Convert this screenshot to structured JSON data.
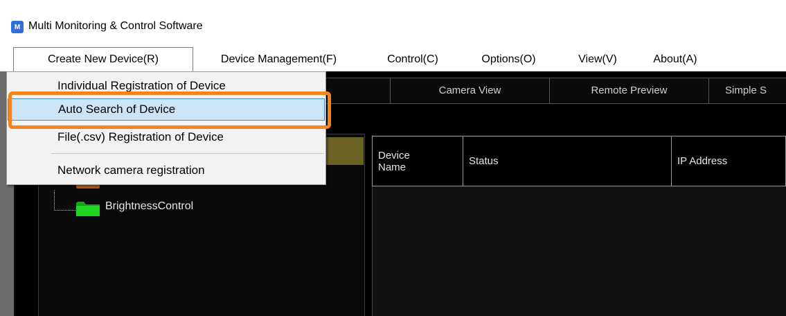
{
  "window": {
    "title": "Multi Monitoring & Control Software",
    "icon": "app-logo-icon",
    "icon_text": "M"
  },
  "menubar": {
    "items": [
      {
        "label": "Create New Device(R)",
        "open": true
      },
      {
        "label": "Device Management(F)"
      },
      {
        "label": "Control(C)"
      },
      {
        "label": "Options(O)"
      },
      {
        "label": "View(V)"
      },
      {
        "label": "About(A)"
      }
    ]
  },
  "dropdown": {
    "items": [
      {
        "label": "Individual Registration of Device"
      },
      {
        "label": "Auto Search of Device",
        "highlighted": true
      },
      {
        "label": "File(.csv) Registration of Device"
      },
      {
        "label": "Network camera registration"
      }
    ]
  },
  "viewbar": {
    "tabs": [
      {
        "label": ""
      },
      {
        "label": "Camera View"
      },
      {
        "label": "Remote Preview"
      },
      {
        "label": "Simple S"
      }
    ]
  },
  "tree": {
    "items": [
      {
        "label": "BrightnessControl",
        "icon": "green-folder-icon"
      }
    ]
  },
  "table": {
    "columns": [
      "Device\nName",
      "Status",
      "IP Address"
    ]
  },
  "colors": {
    "highlight_border": "#f5841f",
    "menu_highlight": "#cce4f7",
    "folder_green": "#1db81d",
    "tree_selection": "#6b6324"
  }
}
